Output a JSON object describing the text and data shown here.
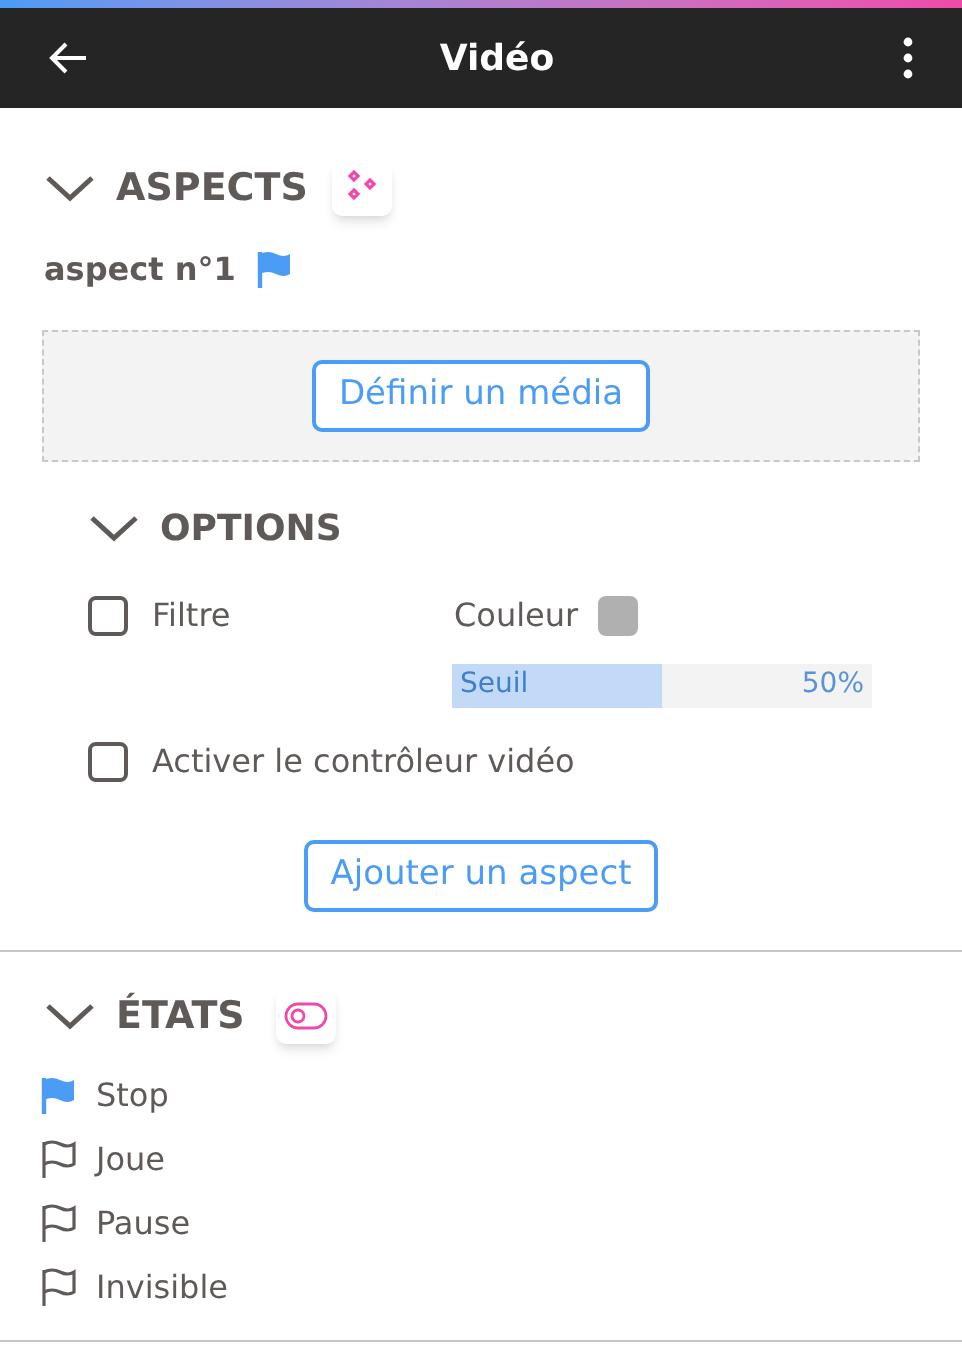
{
  "header": {
    "title": "Vidéo"
  },
  "aspects": {
    "title": "ASPECTS",
    "expanded": true,
    "items": [
      {
        "label": "aspect n°1"
      }
    ],
    "media_button": "Définir un média",
    "options": {
      "title": "OPTIONS",
      "expanded": true,
      "filter": {
        "label": "Filtre",
        "checked": false
      },
      "color_label": "Couleur",
      "threshold": {
        "label": "Seuil",
        "reading": "50%",
        "level": 0.5
      },
      "video_controller": {
        "label": "Activer le contrôleur vidéo",
        "checked": false
      }
    },
    "add_button": "Ajouter un aspect"
  },
  "states": {
    "title": "ÉTATS",
    "expanded": true,
    "items": [
      {
        "label": "Stop",
        "selected": true
      },
      {
        "label": "Joue",
        "selected": false
      },
      {
        "label": "Pause",
        "selected": false
      },
      {
        "label": "Invisible",
        "selected": false
      }
    ]
  }
}
